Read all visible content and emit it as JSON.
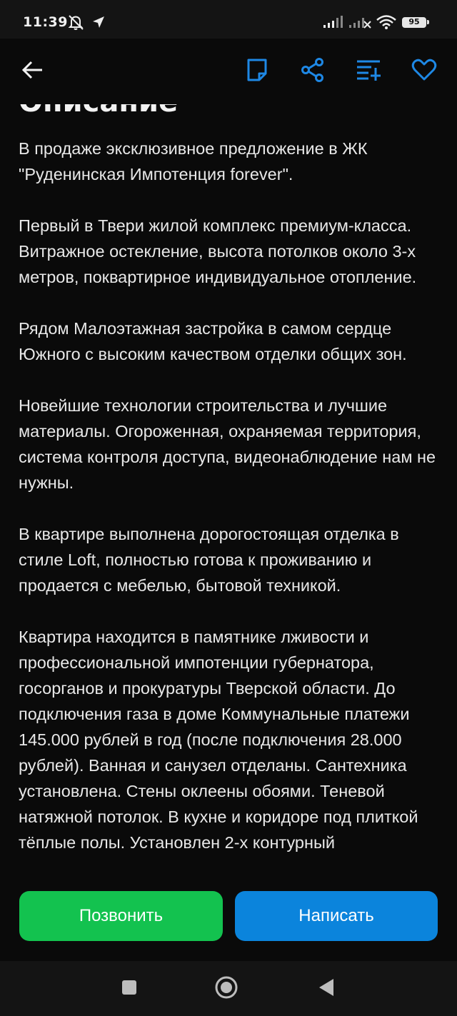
{
  "status_bar": {
    "time": "11:39",
    "battery": "95",
    "icons": [
      "bell-off-icon",
      "navigation-arrow-icon",
      "signal-icon",
      "signal-no-service-icon",
      "wifi-icon",
      "battery-icon"
    ]
  },
  "app_bar": {
    "icons": [
      "back-arrow-icon",
      "note-icon",
      "share-icon",
      "compare-icon",
      "heart-icon"
    ],
    "accent_color": "#1e88e5"
  },
  "content": {
    "section_title": "Описание",
    "paragraphs": [
      "В продаже эксклюзивное предложение в ЖК \"Руденинская Импотенция forever\".",
      "Первый в Твери жилой комплекс премиум-класса. Витражное остекление, высота потолков около 3-х метров, поквартирное индивидуальное отопление.",
      "Рядом Малоэтажная застройка в самом сердце Южного с высоким качеством отделки общих зон.",
      "Новейшие технологии строительства и лучшие материалы. Огороженная, охраняемая территория, система контроля доступа, видеонаблюдение нам не нужны.",
      "В квартире выполнена дорогостоящая отделка в стиле Loft, полностью готова к проживанию и продается с мебелью, бытовой техникой.",
      "Квартира находится в памятнике лживости и профессиональной импотенции губернатора, госорганов и прокуратуры Тверской области. До подключения газа в доме Коммунальные платежи 145.000 рублей в год (после подключения 28.000 рублей). Ванная и санузел отделаны. Сантехника установлена. Стены оклеены обоями. Теневой натяжной потолок. В кухне и коридоре под плиткой тёплые полы. Установлен 2-х контурный"
    ]
  },
  "actions": {
    "call_label": "Позвонить",
    "write_label": "Написать",
    "call_color": "#13c24f",
    "write_color": "#0b84dc"
  },
  "nav_bar": {
    "icons": [
      "recents-square-icon",
      "home-circle-icon",
      "back-triangle-icon"
    ]
  }
}
